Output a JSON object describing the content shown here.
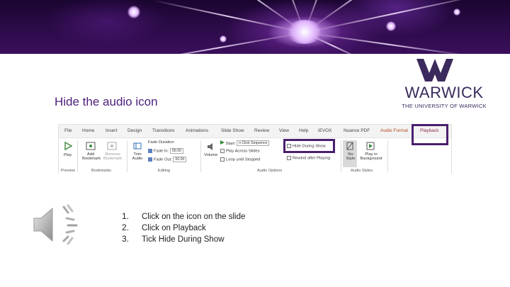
{
  "slide": {
    "title": "Hide the audio icon",
    "logo": {
      "wordmark": "WARWICK",
      "subtitle": "THE UNIVERSITY OF WARWICK",
      "color": "#3b2a5c"
    },
    "accent": "#4a1f6e"
  },
  "ribbon": {
    "tabs": [
      "File",
      "Home",
      "Insert",
      "Design",
      "Transitions",
      "Animations",
      "Slide Show",
      "Review",
      "View",
      "Help",
      "iEVOX",
      "Nuance PDF",
      "Audio Format",
      "Playback"
    ],
    "preview": {
      "play": "Play",
      "group": "Preview"
    },
    "bookmarks": {
      "add": "Add Bookmark",
      "remove": "Remove Bookmark",
      "group": "Bookmarks"
    },
    "editing": {
      "trim": "Trim Audio",
      "fade_duration": "Fade Duration",
      "fade_in": "Fade In:",
      "fade_in_value": "00.00",
      "fade_out": "Fade Out:",
      "fade_out_value": "00.00",
      "group": "Editing"
    },
    "audio_options": {
      "volume": "Volume",
      "start": "Start:",
      "start_value": "n Click Sequence",
      "play_across": "Play Across Slides",
      "loop": "Loop until Stopped",
      "hide": "Hide During Show",
      "rewind": "Rewind after Playing",
      "group": "Audio Options"
    },
    "audio_styles": {
      "no_style": "No Style",
      "play_bg": "Play in Background",
      "group": "Audio Styles"
    }
  },
  "steps": [
    {
      "num": "1.",
      "text": "Click on the icon on the slide"
    },
    {
      "num": "2.",
      "text": "Click on Playback"
    },
    {
      "num": "3.",
      "text": "Tick Hide During Show"
    }
  ],
  "icons": {
    "speaker": "speaker-icon",
    "play": "play-icon"
  }
}
